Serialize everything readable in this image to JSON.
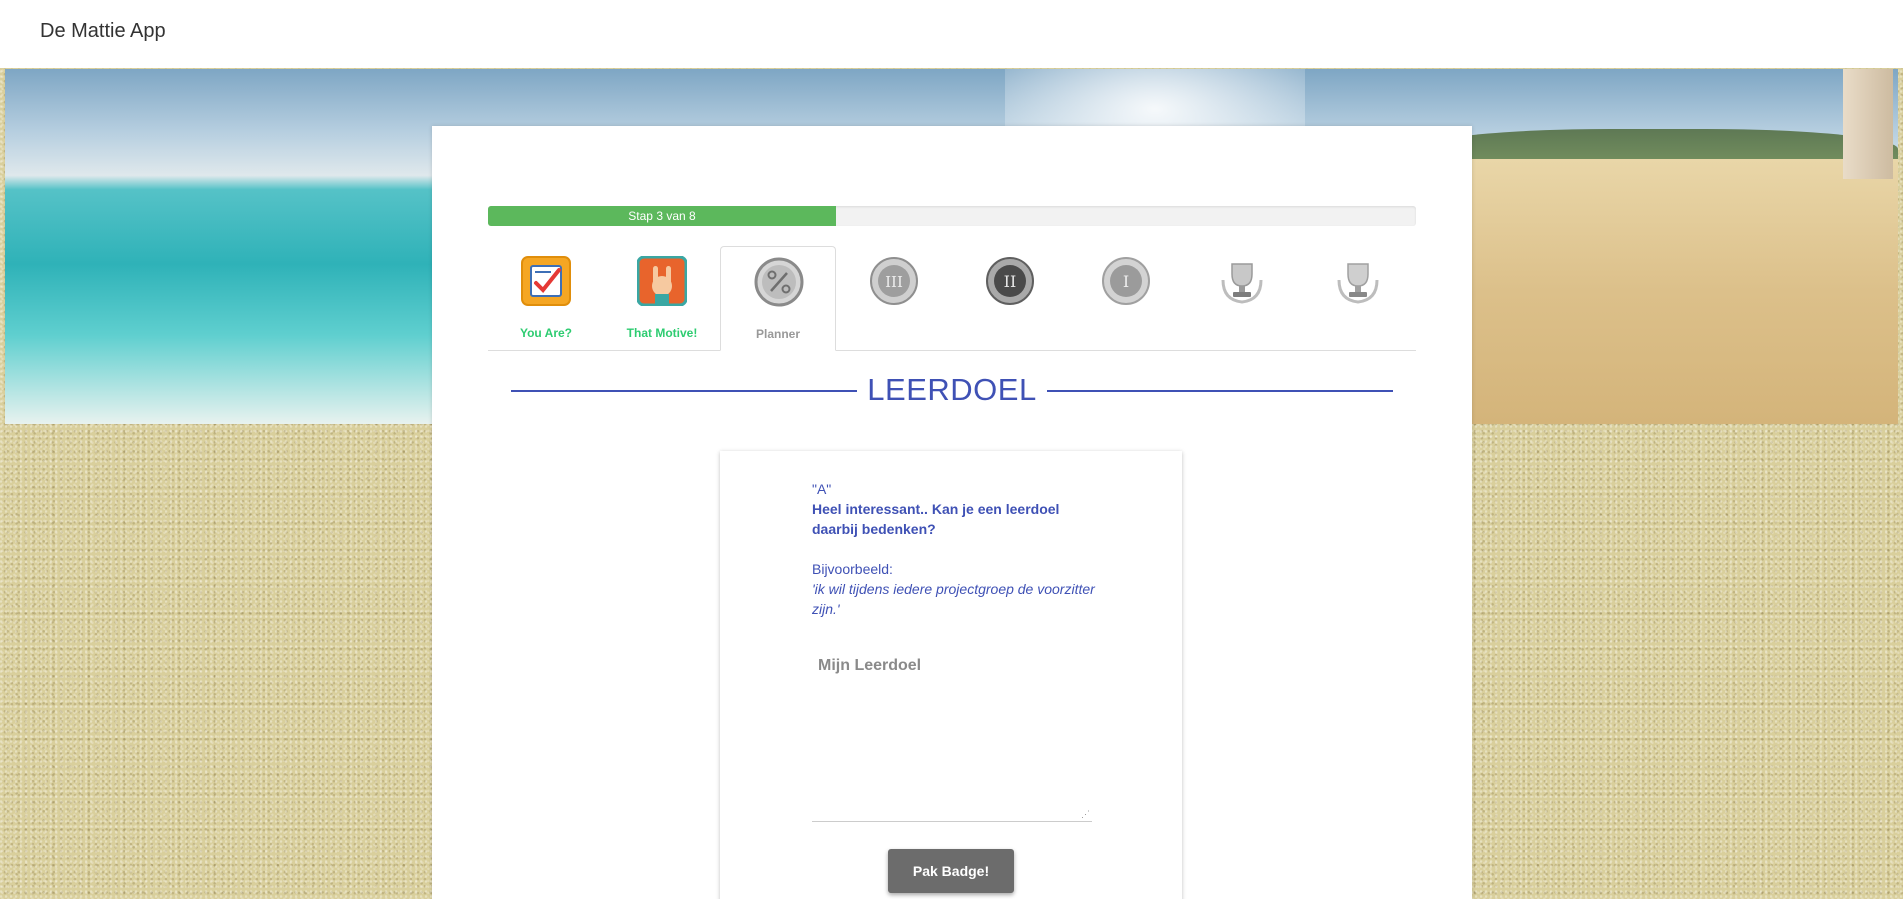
{
  "header": {
    "app_title": "De Mattie App"
  },
  "progress": {
    "label": "Stap 3 van 8",
    "current": 3,
    "total": 8,
    "color": "#5cb85c"
  },
  "tabs": [
    {
      "label": "You Are?",
      "icon": "checklist-icon",
      "state": "done"
    },
    {
      "label": "That Motive!",
      "icon": "rock-hand-icon",
      "state": "done"
    },
    {
      "label": "Planner",
      "icon": "percent-icon",
      "state": "active"
    },
    {
      "label": "",
      "icon": "roman-three-medal-icon",
      "state": "locked"
    },
    {
      "label": "",
      "icon": "roman-two-medal-icon",
      "state": "locked"
    },
    {
      "label": "",
      "icon": "roman-one-medal-icon",
      "state": "locked"
    },
    {
      "label": "",
      "icon": "trophy-icon",
      "state": "locked"
    },
    {
      "label": "",
      "icon": "trophy-icon",
      "state": "locked"
    }
  ],
  "section": {
    "heading": "LEERDOEL"
  },
  "card": {
    "quote": "\"A\"",
    "question": "Heel interessant.. Kan je een leerdoel daarbij bedenken?",
    "example_label": "Bijvoorbeeld:",
    "example_text": "'ik wil tijdens iedere projectgroep de voorzitter zijn.'",
    "textarea_placeholder": "Mijn Leerdoel",
    "textarea_value": "",
    "button_label": "Pak Badge!"
  },
  "colors": {
    "accent": "#3f51b5",
    "done_label": "#2ecc71",
    "button": "#6c6c6c"
  }
}
